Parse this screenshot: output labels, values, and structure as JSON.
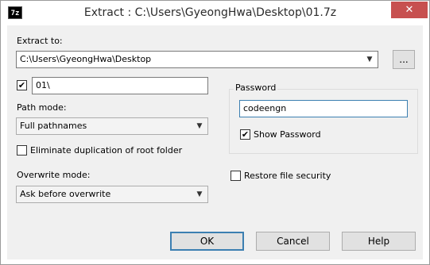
{
  "window": {
    "icon_text": "7z",
    "title": "Extract : C:\\Users\\GyeongHwa\\Desktop\\01.7z",
    "close_glyph": "✕"
  },
  "extract_to": {
    "label": "Extract to:",
    "value": "C:\\Users\\GyeongHwa\\Desktop",
    "browse_label": "..."
  },
  "subfolder": {
    "checked": true,
    "value": "01\\"
  },
  "path_mode": {
    "label": "Path mode:",
    "value": "Full pathnames"
  },
  "eliminate_duplication": {
    "label": "Eliminate duplication of root folder",
    "checked": false
  },
  "overwrite_mode": {
    "label": "Overwrite mode:",
    "value": "Ask before overwrite"
  },
  "password": {
    "group_label": "Password",
    "value": "codeengn",
    "show_label": "Show Password",
    "show_checked": true
  },
  "restore_security": {
    "label": "Restore file security",
    "checked": false
  },
  "buttons": {
    "ok": "OK",
    "cancel": "Cancel",
    "help": "Help"
  },
  "glyphs": {
    "check": "✔",
    "dropdown": "▼"
  }
}
